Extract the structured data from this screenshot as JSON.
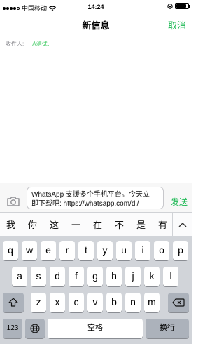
{
  "status_bar": {
    "carrier": "中国移动",
    "time": "14:24",
    "signal_bars": 4,
    "battery_level": 0.9
  },
  "nav": {
    "title": "新信息",
    "cancel": "取消"
  },
  "recipients": {
    "label": "收件人:",
    "value": "A测试、"
  },
  "compose": {
    "line1": "WhatsApp 支援多个手机平台。今天立",
    "line2": "即下载吧: https://whatsapp.com/dl/",
    "send": "发送"
  },
  "candidates": [
    "我",
    "你",
    "这",
    "一",
    "在",
    "不",
    "是",
    "有"
  ],
  "keyboard": {
    "row1": [
      "q",
      "w",
      "e",
      "r",
      "t",
      "y",
      "u",
      "i",
      "o",
      "p"
    ],
    "row2": [
      "a",
      "s",
      "d",
      "f",
      "g",
      "h",
      "j",
      "k",
      "l"
    ],
    "row3": [
      "z",
      "x",
      "c",
      "v",
      "b",
      "n",
      "m"
    ],
    "numbers_key": "123",
    "space_key": "空格",
    "return_key": "换行"
  },
  "colors": {
    "accent_green": "#1db954",
    "recipient_green": "#34c759"
  },
  "icons": [
    "wifi-icon",
    "battery-icon",
    "camera-icon",
    "chevron-up-icon",
    "shift-icon",
    "backspace-icon",
    "globe-icon"
  ]
}
